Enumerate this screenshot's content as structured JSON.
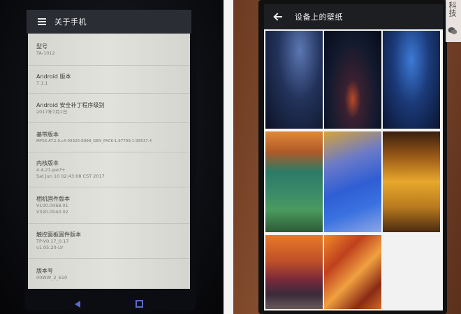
{
  "about_phone": {
    "title": "关于手机",
    "items": [
      {
        "title": "型号",
        "values": [
          "TA-1012"
        ]
      },
      {
        "title": "Android 版本",
        "values": [
          "7.1.1"
        ]
      },
      {
        "title": "Android 安全补丁程序级别",
        "values": [
          "2017年7月1日"
        ]
      },
      {
        "title": "基带版本",
        "values": [
          "MPSS.AT.2.0.c4-00325-8998_GEN_PACK-1.97799.1.99537.4"
        ]
      },
      {
        "title": "内核版本",
        "values": [
          "4.4.21-perf+",
          "Sat Jun 10 02:43:08 CST 2017"
        ]
      },
      {
        "title": "相机固件版本",
        "values": [
          "V100.0068.01",
          "V020.0040.02"
        ]
      },
      {
        "title": "触控面板固件版本",
        "values": [
          "TP-V0.17_0.17",
          "v1.05.20-LV"
        ]
      },
      {
        "title": "版本号",
        "values": [
          "00WW_2_610"
        ]
      }
    ]
  },
  "wallpaper_picker": {
    "title": "设备上的壁纸"
  },
  "watermark": {
    "text": "科技"
  },
  "colors": {
    "appbar": "#2a2d33",
    "list_bg": "#dcdcd6",
    "nav_icon": "#5a6cc8",
    "wallpaper_header": "#1c1e22"
  }
}
